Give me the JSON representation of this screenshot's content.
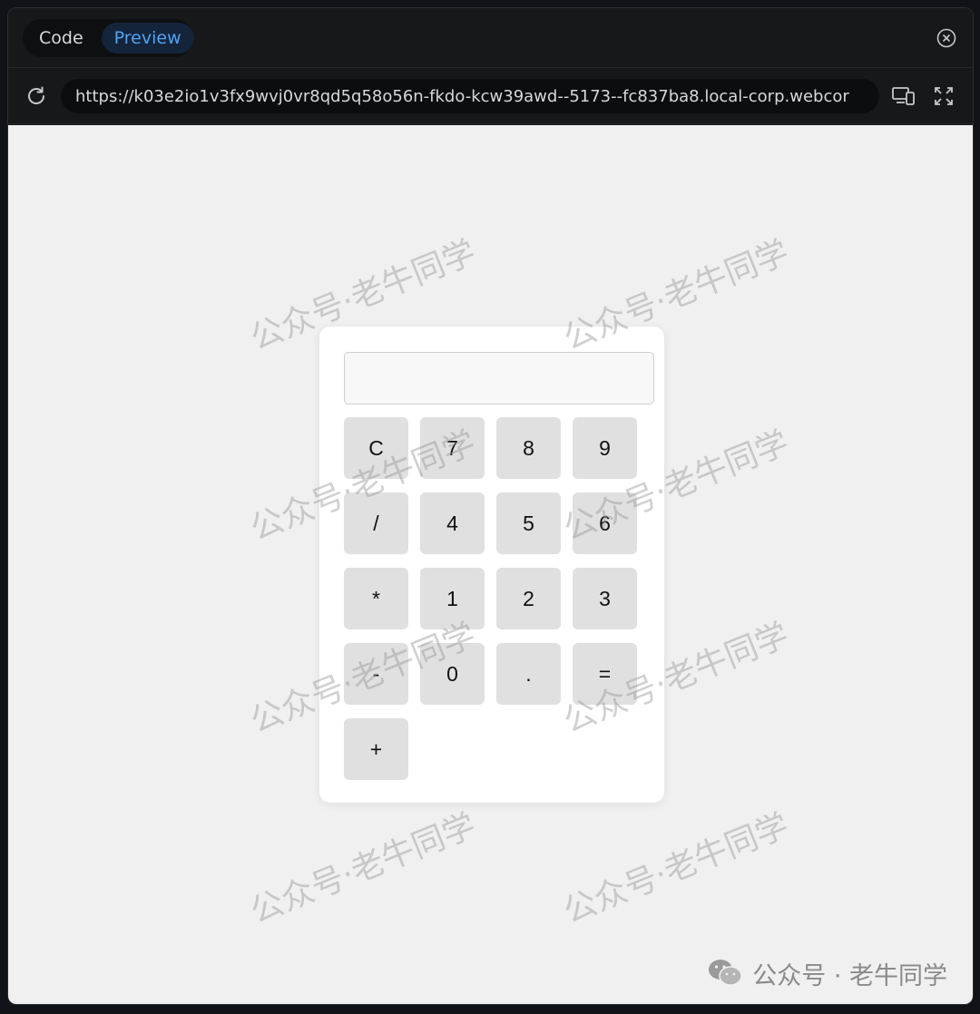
{
  "toolbar": {
    "code_label": "Code",
    "preview_label": "Preview",
    "close_icon": "close-circle-icon"
  },
  "address_bar": {
    "url": "https://k03e2io1v3fx9wvj0vr8qd5q58o56n-fkdo-kcw39awd--5173--fc837ba8.local-corp.webcor",
    "reload_icon": "reload-icon",
    "device_icon": "responsive-devices-icon",
    "fullscreen_icon": "fullscreen-icon"
  },
  "calculator": {
    "display_value": "",
    "keys": [
      "C",
      "7",
      "8",
      "9",
      "/",
      "4",
      "5",
      "6",
      "*",
      "1",
      "2",
      "3",
      "-",
      "0",
      ".",
      "=",
      "+"
    ]
  },
  "watermarks": {
    "text": "公众号·老牛同学",
    "brand_text": "公众号 · 老牛同学",
    "brand_icon": "wechat-logo"
  },
  "colors": {
    "accent": "#4ea3f5",
    "key_bg": "#e0e0e0",
    "preview_bg": "#f0f0f0"
  }
}
